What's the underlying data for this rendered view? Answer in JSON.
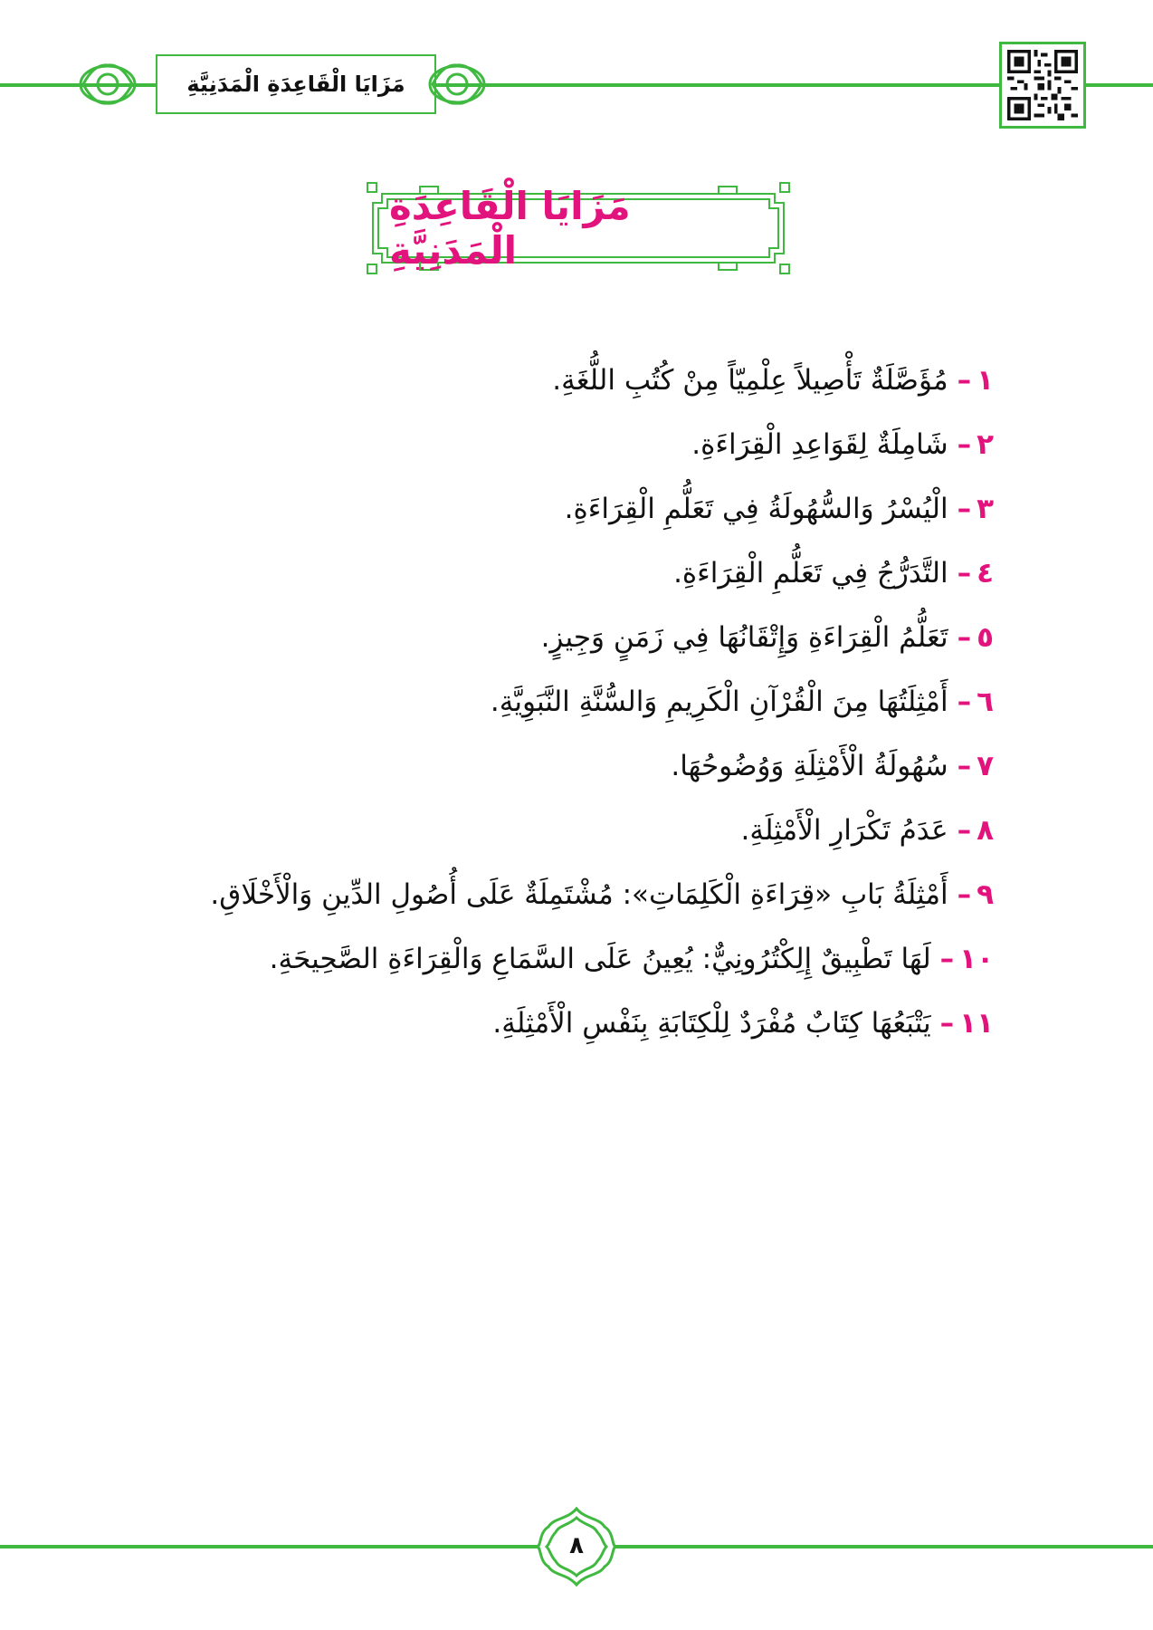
{
  "header": {
    "running_title": "مَزَايَا الْقَاعِدَةِ الْمَدَنِيَّةِ"
  },
  "title": "مَزَايَا الْقَاعِدَةِ الْمَدَنِيَّةِ",
  "items": [
    {
      "num": "١",
      "text": "مُؤَصَّلَةٌ تَأْصِيلاً عِلْمِيّاً مِنْ كُتُبِ اللُّغَةِ."
    },
    {
      "num": "٢",
      "text": "شَامِلَةٌ لِقَوَاعِدِ الْقِرَاءَةِ."
    },
    {
      "num": "٣",
      "text": "الْيُسْرُ وَالسُّهُولَةُ فِي تَعَلُّمِ الْقِرَاءَةِ."
    },
    {
      "num": "٤",
      "text": "التَّدَرُّجُ فِي تَعَلُّمِ الْقِرَاءَةِ."
    },
    {
      "num": "٥",
      "text": "تَعَلُّمُ الْقِرَاءَةِ وَإِتْقَانُهَا فِي زَمَنٍ وَجِيزٍ."
    },
    {
      "num": "٦",
      "text": "أَمْثِلَتُهَا مِنَ الْقُرْآنِ الْكَرِيمِ وَالسُّنَّةِ النَّبَوِيَّةِ."
    },
    {
      "num": "٧",
      "text": "سُهُولَةُ الْأَمْثِلَةِ وَوُضُوحُهَا."
    },
    {
      "num": "٨",
      "text": "عَدَمُ تَكْرَارِ الْأَمْثِلَةِ."
    },
    {
      "num": "٩",
      "text": "أَمْثِلَةُ بَابِ «قِرَاءَةِ الْكَلِمَاتِ»: مُشْتَمِلَةٌ عَلَى أُصُولِ الدِّينِ وَالْأَخْلَاقِ."
    },
    {
      "num": "١٠",
      "text": "لَهَا تَطْبِيقٌ إِلِكْتُرُونِيٌّ: يُعِينُ عَلَى السَّمَاعِ وَالْقِرَاءَةِ الصَّحِيحَةِ."
    },
    {
      "num": "١١",
      "text": "يَتْبَعُهَا كِتَابٌ مُفْرَدٌ لِلْكِتَابَةِ بِنَفْسِ الْأَمْثِلَةِ."
    }
  ],
  "page_number": "٨",
  "colors": {
    "accent_green": "#3fb93f",
    "title_pink": "#e3137e"
  }
}
